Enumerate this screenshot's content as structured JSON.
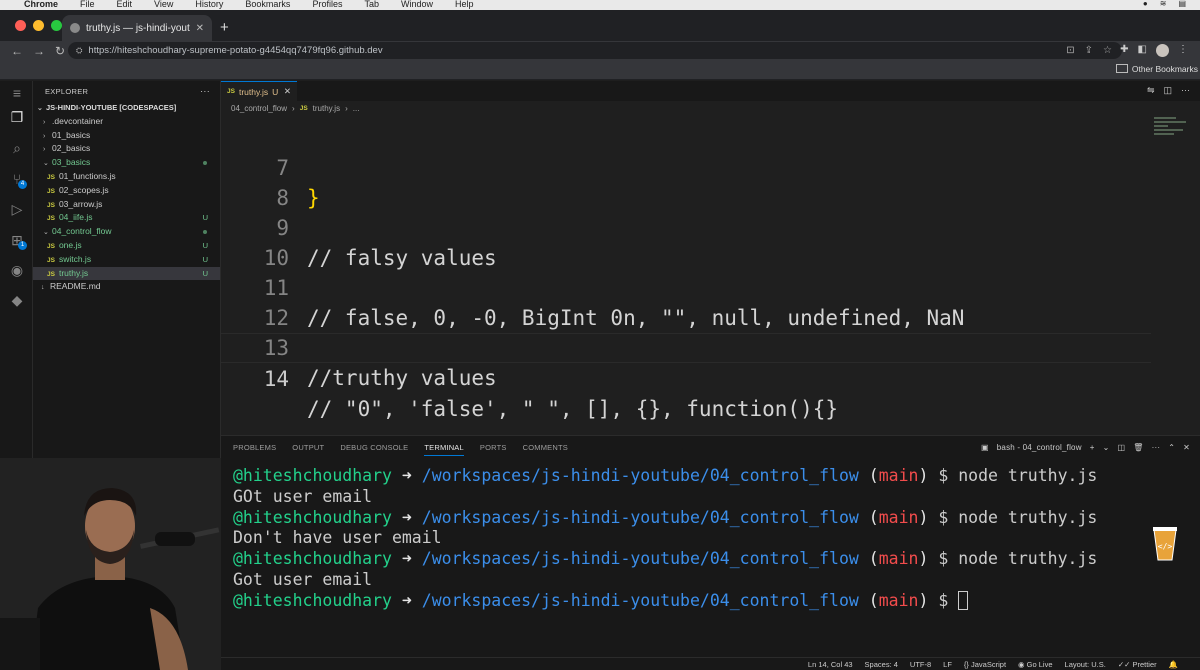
{
  "os_menu": {
    "app": "Chrome",
    "items": [
      "File",
      "Edit",
      "View",
      "History",
      "Bookmarks",
      "Profiles",
      "Tab",
      "Window",
      "Help"
    ]
  },
  "browser": {
    "tab_title": "truthy.js — js-hindi-youtube [C...",
    "url": "https://hiteshchoudhary-supreme-potato-g4454qq7479fq96.github.dev",
    "bookmarks_label": "Other Bookmarks"
  },
  "explorer": {
    "title": "EXPLORER",
    "root": "JS-HINDI-YOUTUBE [CODESPACES]",
    "items": [
      {
        "label": ".devcontainer",
        "kind": "folder",
        "expanded": false,
        "indent": 1,
        "status": ""
      },
      {
        "label": "01_basics",
        "kind": "folder",
        "expanded": false,
        "indent": 1,
        "status": ""
      },
      {
        "label": "02_basics",
        "kind": "folder",
        "expanded": false,
        "indent": 1,
        "status": ""
      },
      {
        "label": "03_basics",
        "kind": "folder",
        "expanded": true,
        "indent": 1,
        "status": "dot"
      },
      {
        "label": "01_functions.js",
        "kind": "file",
        "indent": 2,
        "status": ""
      },
      {
        "label": "02_scopes.js",
        "kind": "file",
        "indent": 2,
        "status": ""
      },
      {
        "label": "03_arrow.js",
        "kind": "file",
        "indent": 2,
        "status": ""
      },
      {
        "label": "04_iife.js",
        "kind": "file",
        "indent": 2,
        "status": "U"
      },
      {
        "label": "04_control_flow",
        "kind": "folder",
        "expanded": true,
        "indent": 1,
        "status": "dot"
      },
      {
        "label": "one.js",
        "kind": "file",
        "indent": 2,
        "status": "U"
      },
      {
        "label": "switch.js",
        "kind": "file",
        "indent": 2,
        "status": "U"
      },
      {
        "label": "truthy.js",
        "kind": "file",
        "indent": 2,
        "status": "U",
        "selected": true
      },
      {
        "label": "README.md",
        "kind": "md",
        "indent": 1,
        "status": ""
      }
    ]
  },
  "editor": {
    "tab_label": "truthy.js",
    "tab_status": "U",
    "breadcrumb": [
      "04_control_flow",
      "truthy.js",
      "..."
    ],
    "lines": [
      {
        "n": "7",
        "text": "}"
      },
      {
        "n": "8",
        "text": ""
      },
      {
        "n": "9",
        "text": "// falsy values"
      },
      {
        "n": "10",
        "text": ""
      },
      {
        "n": "11",
        "text": "// false, 0, -0, BigInt 0n, \"\", null, undefined, NaN"
      },
      {
        "n": "12",
        "text": ""
      },
      {
        "n": "13",
        "text": "//truthy values"
      },
      {
        "n": "14",
        "text": "// \"0\", 'false', \" \", [], {}, function(){}"
      }
    ]
  },
  "panel": {
    "tabs": [
      "PROBLEMS",
      "OUTPUT",
      "DEBUG CONSOLE",
      "TERMINAL",
      "PORTS",
      "COMMENTS"
    ],
    "active_tab": "TERMINAL",
    "terminal_name": "bash - 04_control_flow",
    "prompt": {
      "user": "@hiteshchoudhary",
      "arrow": "➜",
      "path": "/workspaces/js-hindi-youtube/04_control_flow",
      "branch": "main",
      "dollar": "$"
    },
    "terminal_lines": [
      {
        "type": "prompt",
        "command": "node truthy.js"
      },
      {
        "type": "output",
        "text": "GOt user email"
      },
      {
        "type": "prompt",
        "command": "node truthy.js"
      },
      {
        "type": "output",
        "text": "Don't have user email"
      },
      {
        "type": "prompt",
        "command": "node truthy.js"
      },
      {
        "type": "output",
        "text": "Got user email"
      },
      {
        "type": "prompt",
        "command": ""
      }
    ]
  },
  "status_bar": {
    "position": "Ln 14, Col 43",
    "spaces": "Spaces: 4",
    "encoding": "UTF-8",
    "eol": "LF",
    "language": "JavaScript",
    "golive": "Go Live",
    "layout": "Layout: U.S.",
    "prettier": "Prettier"
  },
  "colors": {
    "accent": "#0078d4",
    "git_untracked": "#73c991",
    "terminal_user": "#23d18b",
    "terminal_path": "#3b8eea",
    "terminal_branch": "#f14c4c"
  }
}
